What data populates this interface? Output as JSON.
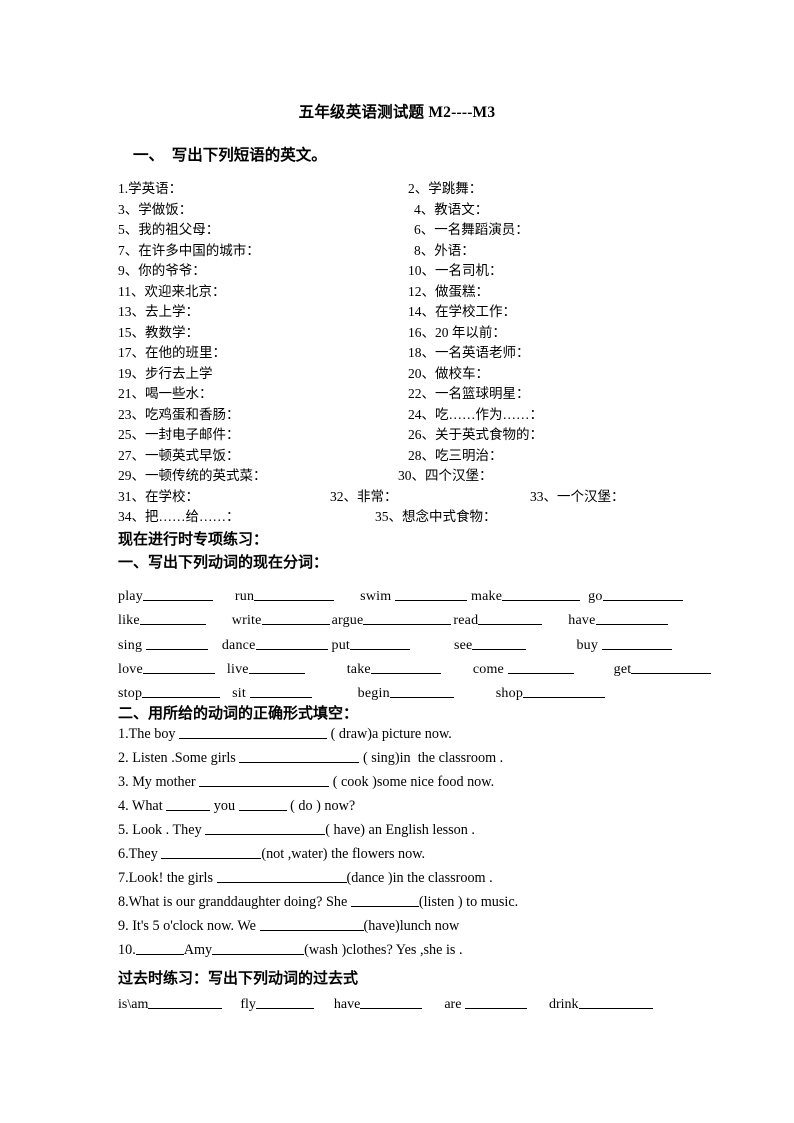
{
  "document": {
    "title": "五年级英语测试题 M2----M3",
    "section1_heading": "一、  写出下列短语的英文。"
  },
  "vocabulary": {
    "rows": [
      {
        "left": "1.学英语：",
        "right": "2、学跳舞："
      },
      {
        "left": "3、学做饭：",
        "right": "4、教语文："
      },
      {
        "left": "5、我的祖父母：",
        "right": "6、一名舞蹈演员："
      },
      {
        "left": "7、在许多中国的城市：",
        "right": "8、外语："
      },
      {
        "left": "9、你的爷爷：",
        "right": "10、一名司机："
      },
      {
        "left": "11、欢迎来北京：",
        "right": "12、做蛋糕："
      },
      {
        "left": "13、去上学：",
        "right": "14、在学校工作："
      },
      {
        "left": "15、教数学：",
        "right": "16、20 年以前："
      },
      {
        "left": "17、在他的班里：",
        "right": "18、一名英语老师："
      },
      {
        "left": "19、步行去上学",
        "right": "20、做校车："
      },
      {
        "left": "21、喝一些水：",
        "right": "22、一名篮球明星："
      },
      {
        "left": "23、吃鸡蛋和香肠：",
        "right": "24、吃……作为……："
      },
      {
        "left": "25、一封电子邮件：",
        "right": "26、关于英式食物的："
      },
      {
        "left": "27、一顿英式早饭：",
        "right": "28、吃三明治："
      }
    ],
    "row29": {
      "c1": "29、一顿传统的英式菜：",
      "c2": "30、四个汉堡："
    },
    "row31": {
      "c1": "31、在学校：",
      "c2": "32、非常：",
      "c3": "33、一个汉堡："
    },
    "row34": {
      "c1": "34、把……给……：",
      "c2": "35、想念中式食物："
    }
  },
  "present_continuous": {
    "heading": "现在进行时专项练习：",
    "part1_heading": "一、写出下列动词的现在分词：",
    "verb_lines": [
      [
        {
          "word": "play",
          "blank": 70
        },
        {
          "word": "run",
          "blank": 80,
          "gap": 22
        },
        {
          "word": "swim ",
          "blank": 72,
          "gap": 26
        },
        {
          "word": "make",
          "blank": 78,
          "gap": 4
        },
        {
          "word": "go",
          "blank": 80,
          "gap": 8
        }
      ],
      [
        {
          "word": "like",
          "blank": 66
        },
        {
          "word": "write",
          "blank": 68,
          "gap": 26
        },
        {
          "word": "argue",
          "blank": 88,
          "gap": 2
        },
        {
          "word": "read",
          "blank": 64,
          "gap": 2
        },
        {
          "word": "have",
          "blank": 72,
          "gap": 26
        }
      ],
      [
        {
          "word": "sing ",
          "blank": 62
        },
        {
          "word": "dance",
          "blank": 72,
          "gap": 14
        },
        {
          "word": "put",
          "blank": 60,
          "gap": 4
        },
        {
          "word": "see",
          "blank": 54,
          "gap": 44
        },
        {
          "word": "buy ",
          "blank": 70,
          "gap": 50
        }
      ],
      [
        {
          "word": "love",
          "blank": 72
        },
        {
          "word": "live",
          "blank": 56,
          "gap": 12
        },
        {
          "word": "take",
          "blank": 70,
          "gap": 42
        },
        {
          "word": "come ",
          "blank": 66,
          "gap": 32
        },
        {
          "word": "get",
          "blank": 80,
          "gap": 40
        }
      ],
      [
        {
          "word": "stop",
          "blank": 78
        },
        {
          "word": "sit ",
          "blank": 62,
          "gap": 12
        },
        {
          "word": "begin",
          "blank": 64,
          "gap": 46
        },
        {
          "word": "shop",
          "blank": 82,
          "gap": 42
        }
      ]
    ],
    "part2_heading": "二、用所给的动词的正确形式填空：",
    "sentences": [
      {
        "pre": "1.The boy ",
        "blank": 148,
        "post": " ( draw)a picture now."
      },
      {
        "pre": "2. Listen .Some girls ",
        "blank": 120,
        "post": " ( sing)in  the classroom ."
      },
      {
        "pre": "3. My mother ",
        "blank": 130,
        "post": " ( cook )some nice food now."
      },
      {
        "pre": "4. What ",
        "blank": 44,
        "mid": " you ",
        "blank2": 48,
        "post": " ( do ) now?"
      },
      {
        "pre": "5. Look . They ",
        "blank": 120,
        "post": "( have) an English lesson ."
      },
      {
        "pre": "6.They ",
        "blank": 100,
        "post": "(not ,water) the flowers now."
      },
      {
        "pre": "7.Look! the girls ",
        "blank": 130,
        "post": "(dance )in the classroom ."
      },
      {
        "pre": "8.What is our granddaughter doing? She ",
        "blank": 68,
        "post": "(listen ) to music."
      },
      {
        "pre": "9. It's 5 o'clock now. We ",
        "blank": 104,
        "post": "(have)lunch now"
      },
      {
        "pre": "10.",
        "blank": 48,
        "mid": "Amy",
        "blank2": 92,
        "post": "(wash )clothes? Yes ,she is ."
      }
    ]
  },
  "past_tense": {
    "heading": "过去时练习：写出下列动词的过去式",
    "verbs": [
      {
        "word": "is\\am",
        "blank": 74
      },
      {
        "word": "fly",
        "blank": 58,
        "gap": 18
      },
      {
        "word": "have",
        "blank": 62,
        "gap": 20
      },
      {
        "word": "are ",
        "blank": 62,
        "gap": 22
      },
      {
        "word": "drink",
        "blank": 74,
        "gap": 22
      }
    ]
  }
}
